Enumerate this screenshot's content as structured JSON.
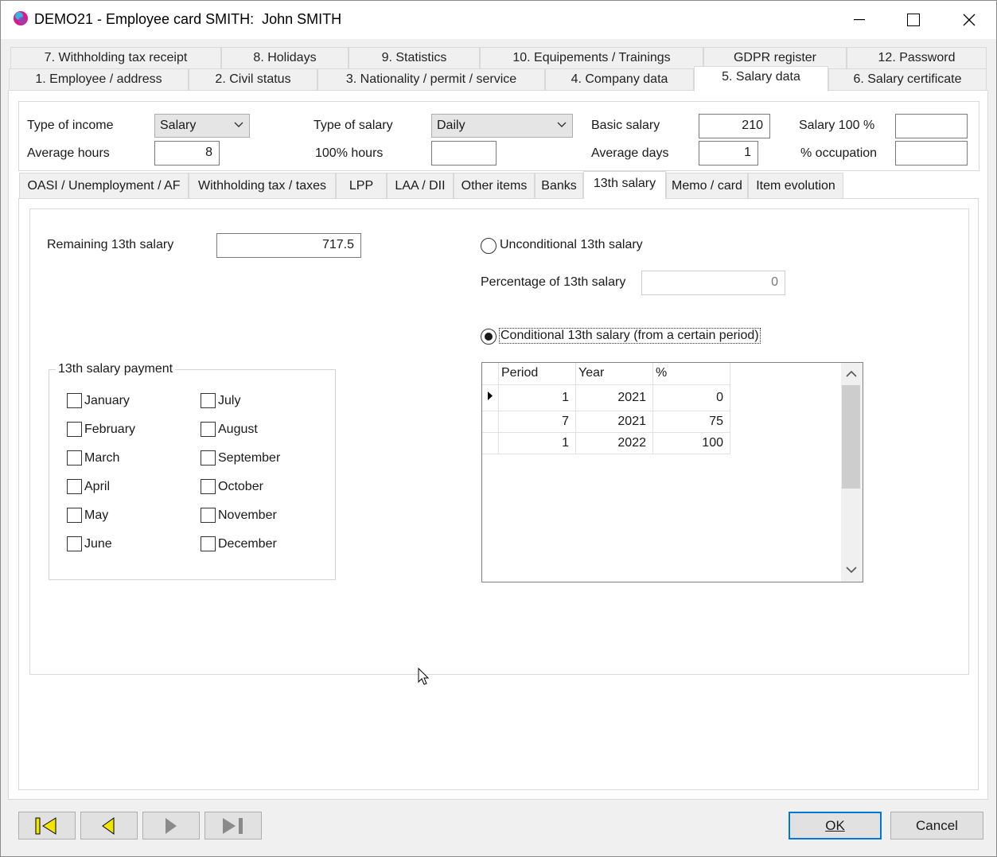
{
  "window": {
    "title": "DEMO21 - Employee card SMITH:  John SMITH"
  },
  "tabs_row1": [
    {
      "label": "7. Withholding tax receipt"
    },
    {
      "label": "8. Holidays"
    },
    {
      "label": "9. Statistics"
    },
    {
      "label": "10. Equipements / Trainings"
    },
    {
      "label": "GDPR register"
    },
    {
      "label": "12. Password"
    }
  ],
  "tabs_row2": [
    {
      "label": "1. Employee / address"
    },
    {
      "label": "2. Civil status"
    },
    {
      "label": "3. Nationality / permit / service"
    },
    {
      "label": "4. Company data"
    },
    {
      "label": "5. Salary data",
      "active": true
    },
    {
      "label": "6. Salary certificate"
    }
  ],
  "header": {
    "type_of_income_label": "Type of income",
    "type_of_income_value": "Salary",
    "average_hours_label": "Average hours",
    "average_hours_value": "8",
    "type_of_salary_label": "Type of salary",
    "type_of_salary_value": "Daily",
    "hours_100_label": "100% hours",
    "hours_100_value": "",
    "basic_salary_label": "Basic salary",
    "basic_salary_value": "210",
    "average_days_label": "Average days",
    "average_days_value": "1",
    "salary_100_label": "Salary 100 %",
    "salary_100_value": "",
    "occupation_label": "% occupation",
    "occupation_value": ""
  },
  "subtabs": [
    {
      "label": "OASI / Unemployment / AF"
    },
    {
      "label": "Withholding tax / taxes"
    },
    {
      "label": "LPP"
    },
    {
      "label": "LAA / DII"
    },
    {
      "label": "Other items"
    },
    {
      "label": "Banks"
    },
    {
      "label": "13th salary",
      "active": true
    },
    {
      "label": "Memo / card"
    },
    {
      "label": "Item evolution"
    }
  ],
  "salary13": {
    "remaining_label": "Remaining 13th salary",
    "remaining_value": "717.5",
    "unconditional_label": "Unconditional 13th salary",
    "percentage_label": "Percentage of 13th salary",
    "percentage_value": "0",
    "conditional_label": "Conditional 13th salary (from a certain period)",
    "selected_option": "conditional",
    "payment_group_title": "13th salary payment",
    "months_left": [
      "January",
      "February",
      "March",
      "April",
      "May",
      "June"
    ],
    "months_right": [
      "July",
      "August",
      "September",
      "October",
      "November",
      "December"
    ]
  },
  "period_grid": {
    "columns": [
      "Period",
      "Year",
      "%"
    ],
    "rows": [
      {
        "period": "1",
        "year": "2021",
        "percent": "0"
      },
      {
        "period": "7",
        "year": "2021",
        "percent": "75"
      },
      {
        "period": "1",
        "year": "2022",
        "percent": "100"
      }
    ]
  },
  "footer": {
    "ok_label": "OK",
    "cancel_label": "Cancel"
  },
  "colors": {
    "nav_arrow": "#f2e600",
    "default_button_border": "#0078d7"
  }
}
